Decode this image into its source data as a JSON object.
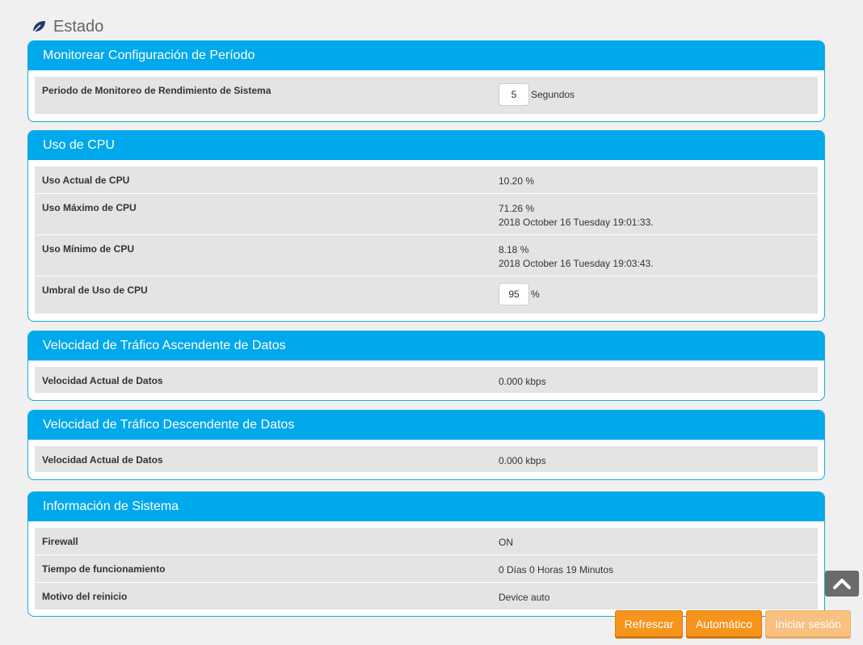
{
  "header": {
    "title": "Estado",
    "icon": "leaf-icon"
  },
  "monitor": {
    "title": "Monitorear Configuración de Período",
    "period_label": "Periodo de Monitoreo de Rendimiento de Sistema",
    "period_value": "5",
    "period_unit": "Segundos"
  },
  "cpu": {
    "title": "Uso de CPU",
    "current_label": "Uso Actual de CPU",
    "current_value": "10.20 %",
    "max_label": "Uso Máximo de CPU",
    "max_value": "71.26 %",
    "max_time": "2018 October 16 Tuesday 19:01:33.",
    "min_label": "Uso Mínimo de CPU",
    "min_value": "8.18 %",
    "min_time": "2018 October 16 Tuesday 19:03:43.",
    "threshold_label": "Umbral de Uso de CPU",
    "threshold_value": "95",
    "threshold_unit": "%"
  },
  "upstream": {
    "title": "Velocidad de Tráfico Ascendente de Datos",
    "rate_label": "Velocidad Actual de Datos",
    "rate_value": "0.000 kbps"
  },
  "downstream": {
    "title": "Velocidad de Tráfico Descendente de Datos",
    "rate_label": "Velocidad Actual de Datos",
    "rate_value": "0.000 kbps"
  },
  "sysinfo": {
    "title": "Información de Sistema",
    "firewall_label": "Firewall",
    "firewall_value": "ON",
    "uptime_label": "Tiempo de funcionamiento",
    "uptime_value": "0 Días 0 Horas 19 Minutos",
    "reboot_label": "Motivo del reinicio",
    "reboot_value": "Device auto"
  },
  "buttons": {
    "refresh": "Refrescar",
    "auto": "Automático",
    "login": "Iniciar sesión"
  },
  "colors": {
    "panel_header": "#00a8ec",
    "button": "#f7941d",
    "button_disabled": "#f8c17f",
    "leaf_icon": "#1b3a6b"
  }
}
